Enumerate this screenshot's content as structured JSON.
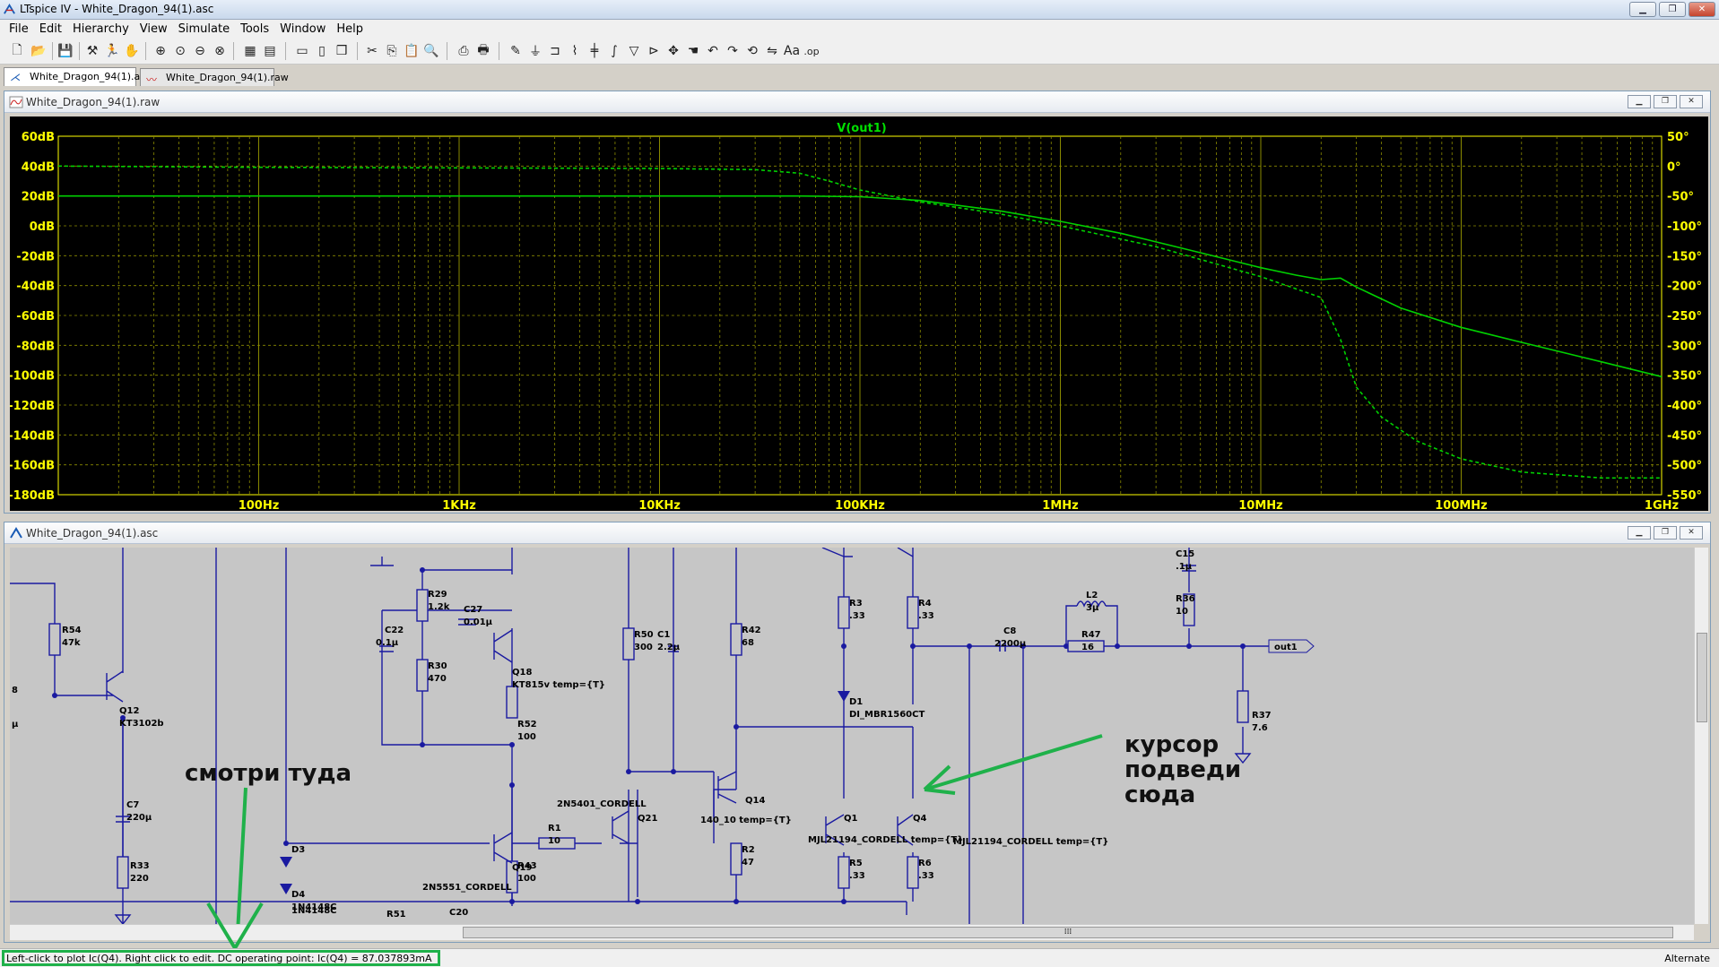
{
  "window": {
    "title": "LTspice IV - White_Dragon_94(1).asc"
  },
  "menu": [
    "File",
    "Edit",
    "Hierarchy",
    "View",
    "Simulate",
    "Tools",
    "Window",
    "Help"
  ],
  "tabs": [
    {
      "label": "White_Dragon_94(1).asc",
      "active": true,
      "icon": "schematic-icon"
    },
    {
      "label": "White_Dragon_94(1).raw",
      "active": false,
      "icon": "waveform-icon"
    }
  ],
  "wave_panel": {
    "title": "White_Dragon_94(1).raw"
  },
  "schem_panel": {
    "title": "White_Dragon_94(1).asc"
  },
  "chart_data": {
    "type": "line",
    "title": "V(out1)",
    "x_scale": "log",
    "xlim": [
      10,
      1000000000
    ],
    "x_ticks": [
      {
        "v": 100,
        "label": "100Hz"
      },
      {
        "v": 1000,
        "label": "1KHz"
      },
      {
        "v": 10000,
        "label": "10KHz"
      },
      {
        "v": 100000,
        "label": "100KHz"
      },
      {
        "v": 1000000,
        "label": "1MHz"
      },
      {
        "v": 10000000,
        "label": "10MHz"
      },
      {
        "v": 100000000,
        "label": "100MHz"
      },
      {
        "v": 1000000000,
        "label": "1GHz"
      }
    ],
    "ylim": [
      -180,
      60
    ],
    "y_ticks": [
      "60dB",
      "40dB",
      "20dB",
      "0dB",
      "-20dB",
      "-40dB",
      "-60dB",
      "-80dB",
      "-100dB",
      "-120dB",
      "-140dB",
      "-160dB",
      "-180dB"
    ],
    "y2lim": [
      -550,
      50
    ],
    "y2_ticks": [
      "50°",
      "0°",
      "-50°",
      "-100°",
      "-150°",
      "-200°",
      "-250°",
      "-300°",
      "-350°",
      "-400°",
      "-450°",
      "-500°",
      "-550°"
    ],
    "grid": true,
    "colors": {
      "bg": "#000000",
      "grid": "#8a8a00",
      "axis": "#ffff00",
      "trace": "#00d000"
    },
    "series": [
      {
        "name": "magnitude",
        "style": "solid",
        "axis": "left",
        "x": [
          10,
          1000,
          10000,
          50000,
          100000,
          200000,
          500000,
          1000000,
          2000000,
          5000000,
          10000000,
          15000000,
          20000000,
          25000000,
          30000000,
          50000000,
          100000000,
          200000000,
          500000000,
          1000000000
        ],
        "y": [
          20,
          20,
          20,
          20,
          19.5,
          17,
          10,
          3,
          -5,
          -18,
          -28,
          -33,
          -36,
          -35,
          -41,
          -55,
          -68,
          -78,
          -91,
          -101
        ]
      },
      {
        "name": "phase",
        "style": "dashed",
        "axis": "right",
        "x": [
          10,
          100,
          1000,
          10000,
          30000,
          50000,
          70000,
          100000,
          200000,
          500000,
          1000000,
          3000000,
          10000000,
          20000000,
          25000000,
          30000000,
          40000000,
          60000000,
          100000000,
          200000000,
          500000000,
          1000000000
        ],
        "y": [
          0,
          -2,
          -3,
          -4,
          -6,
          -12,
          -25,
          -40,
          -60,
          -80,
          -100,
          -135,
          -185,
          -220,
          -290,
          -370,
          -420,
          -460,
          -490,
          -512,
          -522,
          -522
        ]
      }
    ]
  },
  "schematic": {
    "components": [
      {
        "ref": "R54",
        "val": "47k"
      },
      {
        "ref": "Q12",
        "val": "KT3102b"
      },
      {
        "ref": "C7",
        "val": "220µ"
      },
      {
        "ref": "R33",
        "val": "220"
      },
      {
        "ref": "R29",
        "val": "1.2k"
      },
      {
        "ref": "C27",
        "val": "0.01µ"
      },
      {
        "ref": "C22",
        "val": "0.1µ"
      },
      {
        "ref": "R30",
        "val": "470"
      },
      {
        "ref": "Q18",
        "val": "KT815v temp={T}"
      },
      {
        "ref": "R52",
        "val": "100"
      },
      {
        "ref": "R1",
        "val": "10"
      },
      {
        "ref": "Q19",
        "val": "2N5551_CORDELL"
      },
      {
        "ref": "R43",
        "val": "100"
      },
      {
        "ref": "D3",
        "val": ""
      },
      {
        "ref": "D4",
        "val": "1N4148C"
      },
      {
        "ref": "R50",
        "val": "300"
      },
      {
        "ref": "C1",
        "val": "2.2µ"
      },
      {
        "ref": "Q21",
        "val": "2N5401_CORDELL"
      },
      {
        "ref": "R42",
        "val": "68"
      },
      {
        "ref": "Q14",
        "val": "140_10 temp={T}"
      },
      {
        "ref": "R2",
        "val": "47"
      },
      {
        "ref": "R3",
        "val": ".33"
      },
      {
        "ref": "R4",
        "val": ".33"
      },
      {
        "ref": "D1",
        "val": "DI_MBR1560CT"
      },
      {
        "ref": "Q1",
        "val": "MJL21194_CORDELL temp={T}"
      },
      {
        "ref": "Q4",
        "val": "MJL21194_CORDELL temp={T}"
      },
      {
        "ref": "R5",
        "val": ".33"
      },
      {
        "ref": "R6",
        "val": ".33"
      },
      {
        "ref": "C8",
        "val": "2200µ"
      },
      {
        "ref": "L2",
        "val": "3µ"
      },
      {
        "ref": "R47",
        "val": "16"
      },
      {
        "ref": "C15",
        "val": ".1µ"
      },
      {
        "ref": "R36",
        "val": "10"
      },
      {
        "ref": "R37",
        "val": "7.6"
      },
      {
        "ref": "R51",
        "val": ""
      },
      {
        "ref": "C20",
        "val": ""
      }
    ],
    "labels": {
      "out1": "out1",
      "edge8": "8",
      "edgemu": "µ",
      "d4b": "1N4148C"
    },
    "annotations": {
      "look_there": "смотри туда",
      "cursor_line1": "курсор",
      "cursor_line2": "подведи",
      "cursor_line3": "сюда"
    }
  },
  "status": {
    "text": "Left-click to plot Ic(Q4).  Right click to edit.  DC operating point: Ic(Q4) = 87.037893mA",
    "right": "Alternate"
  }
}
